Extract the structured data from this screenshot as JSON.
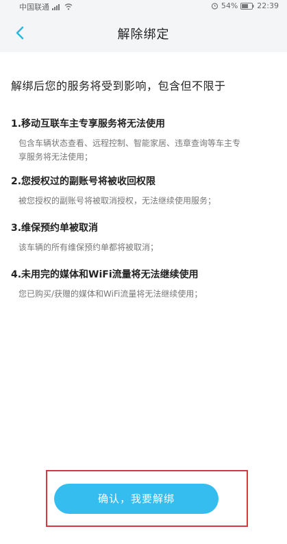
{
  "status_bar": {
    "carrier": "中国联通",
    "network": "4G",
    "battery_percent": "54%",
    "time": "22:39"
  },
  "header": {
    "title": "解除绑定",
    "back_icon": "chevron-left-icon"
  },
  "intro": "解绑后您的服务将受到影响，包含但不限于",
  "sections": [
    {
      "title": "1.移动互联车主专享服务将无法使用",
      "desc": "包含车辆状态查看、远程控制、智能家居、违章查询等车主专享服务将无法使用；"
    },
    {
      "title": "2.您授权过的副账号将被收回权限",
      "desc": "被您授权的副账号将被取消授权，无法继续使用服务；"
    },
    {
      "title": "3.维保预约单被取消",
      "desc": "该车辆的所有维保预约单都将被取消；"
    },
    {
      "title": "4.未用完的媒体和WiFi流量将无法继续使用",
      "desc": "您已购买/获赠的媒体和WiFi流量将无法继续使用；"
    }
  ],
  "confirm_button": {
    "label": "确认，我要解绑"
  },
  "colors": {
    "accent": "#35bdf0",
    "back_icon": "#2bb6d8",
    "highlight": "#d4383c"
  }
}
